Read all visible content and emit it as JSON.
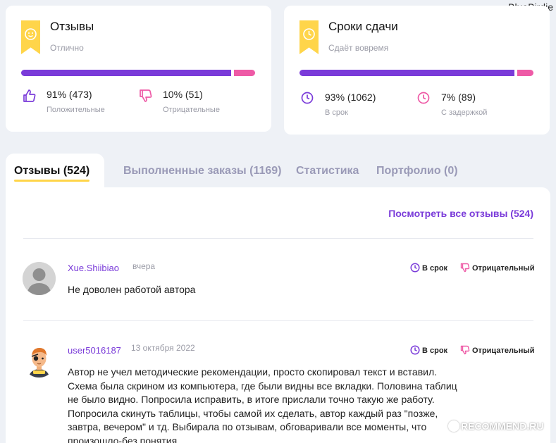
{
  "watermark_top": "BlueBirdie",
  "reviews_card": {
    "title": "Отзывы",
    "subtitle": "Отлично",
    "progress_positive": 0.91,
    "positive_value": "91% (473)",
    "positive_label": "Положительные",
    "negative_value": "10% (51)",
    "negative_label": "Отрицательные",
    "icons": [
      "smile-icon",
      "thumbs-up-icon",
      "thumbs-down-icon"
    ]
  },
  "deadlines_card": {
    "title": "Сроки сдачи",
    "subtitle": "Сдаёт вовремя",
    "progress_on_time": 0.93,
    "on_time_value": "93% (1062)",
    "on_time_label": "В срок",
    "delayed_value": "7% (89)",
    "delayed_label": "С задержкой",
    "icons": [
      "clock-icon"
    ]
  },
  "tabs": [
    {
      "label": "Отзывы (524)",
      "active": true
    },
    {
      "label": "Выполненные заказы (1169)",
      "active": false
    },
    {
      "label": "Статистика",
      "active": false
    },
    {
      "label": "Портфолио (0)",
      "active": false
    }
  ],
  "see_all_link": "Посмотреть все отзывы (524)",
  "reviews": [
    {
      "username": "Xue.Shiibiao",
      "date": "вчера",
      "deadline_tag": "В срок",
      "rating_tag": "Отрицательный",
      "text": "Не доволен работой автора"
    },
    {
      "username": "user5016187",
      "date": "13 октября 2022",
      "deadline_tag": "В срок",
      "rating_tag": "Отрицательный",
      "text_lines": [
        "Автор не учел методические рекомендации, просто скопировал текст и вставил.",
        "Схема была скрином из компьютера, где были видны все вкладки. Половина таблиц",
        "не было видно. Попросила исправить, в итоге прислали точно такую же работу.",
        "Попросила скинуть таблицы, чтобы самой их сделать, автор каждый раз \"позже,",
        "завтра, вечером\" и тд. Выбирала по отзывам, обговаривали все моменты, что",
        "произошло-без понятия"
      ]
    }
  ],
  "watermark_bottom": "RECOMMEND.RU",
  "colors": {
    "accent": "#7a3bd9",
    "negative": "#ee5aa6",
    "badge": "#ffd54a",
    "background": "#eef1f6"
  }
}
